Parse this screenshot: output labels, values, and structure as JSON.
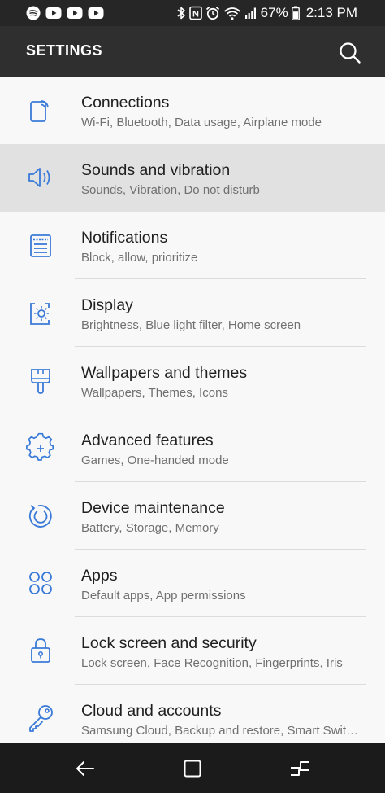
{
  "status_bar": {
    "battery": "67%",
    "time": "2:13 PM",
    "left_icons": [
      "spotify-icon",
      "youtube-icon",
      "youtube-icon",
      "youtube-icon"
    ],
    "right_icons": [
      "bluetooth-icon",
      "nfc-icon",
      "alarm-icon",
      "wifi-icon",
      "signal-icon",
      "battery-icon"
    ]
  },
  "header": {
    "title": "SETTINGS",
    "search_icon": "search-icon"
  },
  "accent_color": "#3a7ad8",
  "items": [
    {
      "title": "Connections",
      "subtitle": "Wi-Fi, Bluetooth, Data usage, Airplane mode",
      "icon": "connections-icon"
    },
    {
      "title": "Sounds and vibration",
      "subtitle": "Sounds, Vibration, Do not disturb",
      "icon": "speaker-icon"
    },
    {
      "title": "Notifications",
      "subtitle": "Block, allow, prioritize",
      "icon": "notifications-icon"
    },
    {
      "title": "Display",
      "subtitle": "Brightness, Blue light filter, Home screen",
      "icon": "display-icon"
    },
    {
      "title": "Wallpapers and themes",
      "subtitle": "Wallpapers, Themes, Icons",
      "icon": "brush-icon"
    },
    {
      "title": "Advanced features",
      "subtitle": "Games, One-handed mode",
      "icon": "gear-plus-icon"
    },
    {
      "title": "Device maintenance",
      "subtitle": "Battery, Storage, Memory",
      "icon": "maintenance-icon"
    },
    {
      "title": "Apps",
      "subtitle": "Default apps, App permissions",
      "icon": "apps-icon"
    },
    {
      "title": "Lock screen and security",
      "subtitle": "Lock screen, Face Recognition, Fingerprints, Iris",
      "icon": "lock-icon"
    },
    {
      "title": "Cloud and accounts",
      "subtitle": "Samsung Cloud, Backup and restore, Smart Swit…",
      "icon": "key-icon"
    }
  ],
  "nav_bar": {
    "icons": [
      "back-icon",
      "home-icon",
      "recents-icon"
    ]
  }
}
